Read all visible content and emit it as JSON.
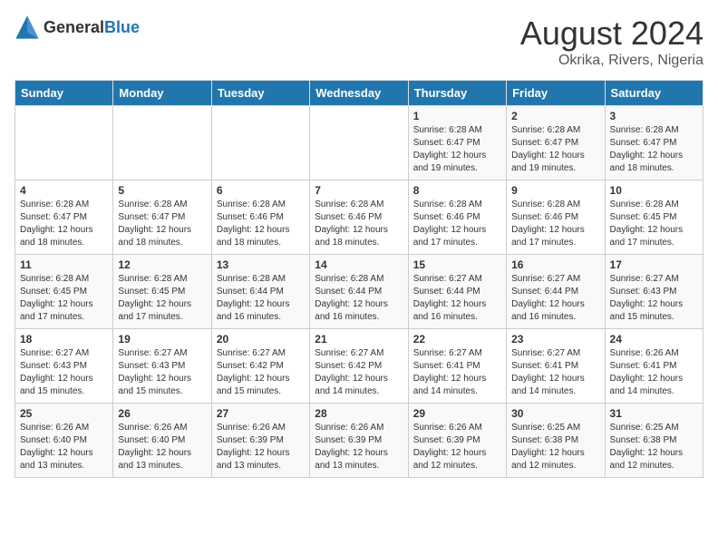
{
  "logo": {
    "general": "General",
    "blue": "Blue"
  },
  "title": "August 2024",
  "location": "Okrika, Rivers, Nigeria",
  "weekdays": [
    "Sunday",
    "Monday",
    "Tuesday",
    "Wednesday",
    "Thursday",
    "Friday",
    "Saturday"
  ],
  "weeks": [
    [
      {
        "day": "",
        "info": ""
      },
      {
        "day": "",
        "info": ""
      },
      {
        "day": "",
        "info": ""
      },
      {
        "day": "",
        "info": ""
      },
      {
        "day": "1",
        "info": "Sunrise: 6:28 AM\nSunset: 6:47 PM\nDaylight: 12 hours\nand 19 minutes."
      },
      {
        "day": "2",
        "info": "Sunrise: 6:28 AM\nSunset: 6:47 PM\nDaylight: 12 hours\nand 19 minutes."
      },
      {
        "day": "3",
        "info": "Sunrise: 6:28 AM\nSunset: 6:47 PM\nDaylight: 12 hours\nand 18 minutes."
      }
    ],
    [
      {
        "day": "4",
        "info": "Sunrise: 6:28 AM\nSunset: 6:47 PM\nDaylight: 12 hours\nand 18 minutes."
      },
      {
        "day": "5",
        "info": "Sunrise: 6:28 AM\nSunset: 6:47 PM\nDaylight: 12 hours\nand 18 minutes."
      },
      {
        "day": "6",
        "info": "Sunrise: 6:28 AM\nSunset: 6:46 PM\nDaylight: 12 hours\nand 18 minutes."
      },
      {
        "day": "7",
        "info": "Sunrise: 6:28 AM\nSunset: 6:46 PM\nDaylight: 12 hours\nand 18 minutes."
      },
      {
        "day": "8",
        "info": "Sunrise: 6:28 AM\nSunset: 6:46 PM\nDaylight: 12 hours\nand 17 minutes."
      },
      {
        "day": "9",
        "info": "Sunrise: 6:28 AM\nSunset: 6:46 PM\nDaylight: 12 hours\nand 17 minutes."
      },
      {
        "day": "10",
        "info": "Sunrise: 6:28 AM\nSunset: 6:45 PM\nDaylight: 12 hours\nand 17 minutes."
      }
    ],
    [
      {
        "day": "11",
        "info": "Sunrise: 6:28 AM\nSunset: 6:45 PM\nDaylight: 12 hours\nand 17 minutes."
      },
      {
        "day": "12",
        "info": "Sunrise: 6:28 AM\nSunset: 6:45 PM\nDaylight: 12 hours\nand 17 minutes."
      },
      {
        "day": "13",
        "info": "Sunrise: 6:28 AM\nSunset: 6:44 PM\nDaylight: 12 hours\nand 16 minutes."
      },
      {
        "day": "14",
        "info": "Sunrise: 6:28 AM\nSunset: 6:44 PM\nDaylight: 12 hours\nand 16 minutes."
      },
      {
        "day": "15",
        "info": "Sunrise: 6:27 AM\nSunset: 6:44 PM\nDaylight: 12 hours\nand 16 minutes."
      },
      {
        "day": "16",
        "info": "Sunrise: 6:27 AM\nSunset: 6:44 PM\nDaylight: 12 hours\nand 16 minutes."
      },
      {
        "day": "17",
        "info": "Sunrise: 6:27 AM\nSunset: 6:43 PM\nDaylight: 12 hours\nand 15 minutes."
      }
    ],
    [
      {
        "day": "18",
        "info": "Sunrise: 6:27 AM\nSunset: 6:43 PM\nDaylight: 12 hours\nand 15 minutes."
      },
      {
        "day": "19",
        "info": "Sunrise: 6:27 AM\nSunset: 6:43 PM\nDaylight: 12 hours\nand 15 minutes."
      },
      {
        "day": "20",
        "info": "Sunrise: 6:27 AM\nSunset: 6:42 PM\nDaylight: 12 hours\nand 15 minutes."
      },
      {
        "day": "21",
        "info": "Sunrise: 6:27 AM\nSunset: 6:42 PM\nDaylight: 12 hours\nand 14 minutes."
      },
      {
        "day": "22",
        "info": "Sunrise: 6:27 AM\nSunset: 6:41 PM\nDaylight: 12 hours\nand 14 minutes."
      },
      {
        "day": "23",
        "info": "Sunrise: 6:27 AM\nSunset: 6:41 PM\nDaylight: 12 hours\nand 14 minutes."
      },
      {
        "day": "24",
        "info": "Sunrise: 6:26 AM\nSunset: 6:41 PM\nDaylight: 12 hours\nand 14 minutes."
      }
    ],
    [
      {
        "day": "25",
        "info": "Sunrise: 6:26 AM\nSunset: 6:40 PM\nDaylight: 12 hours\nand 13 minutes."
      },
      {
        "day": "26",
        "info": "Sunrise: 6:26 AM\nSunset: 6:40 PM\nDaylight: 12 hours\nand 13 minutes."
      },
      {
        "day": "27",
        "info": "Sunrise: 6:26 AM\nSunset: 6:39 PM\nDaylight: 12 hours\nand 13 minutes."
      },
      {
        "day": "28",
        "info": "Sunrise: 6:26 AM\nSunset: 6:39 PM\nDaylight: 12 hours\nand 13 minutes."
      },
      {
        "day": "29",
        "info": "Sunrise: 6:26 AM\nSunset: 6:39 PM\nDaylight: 12 hours\nand 12 minutes."
      },
      {
        "day": "30",
        "info": "Sunrise: 6:25 AM\nSunset: 6:38 PM\nDaylight: 12 hours\nand 12 minutes."
      },
      {
        "day": "31",
        "info": "Sunrise: 6:25 AM\nSunset: 6:38 PM\nDaylight: 12 hours\nand 12 minutes."
      }
    ]
  ]
}
